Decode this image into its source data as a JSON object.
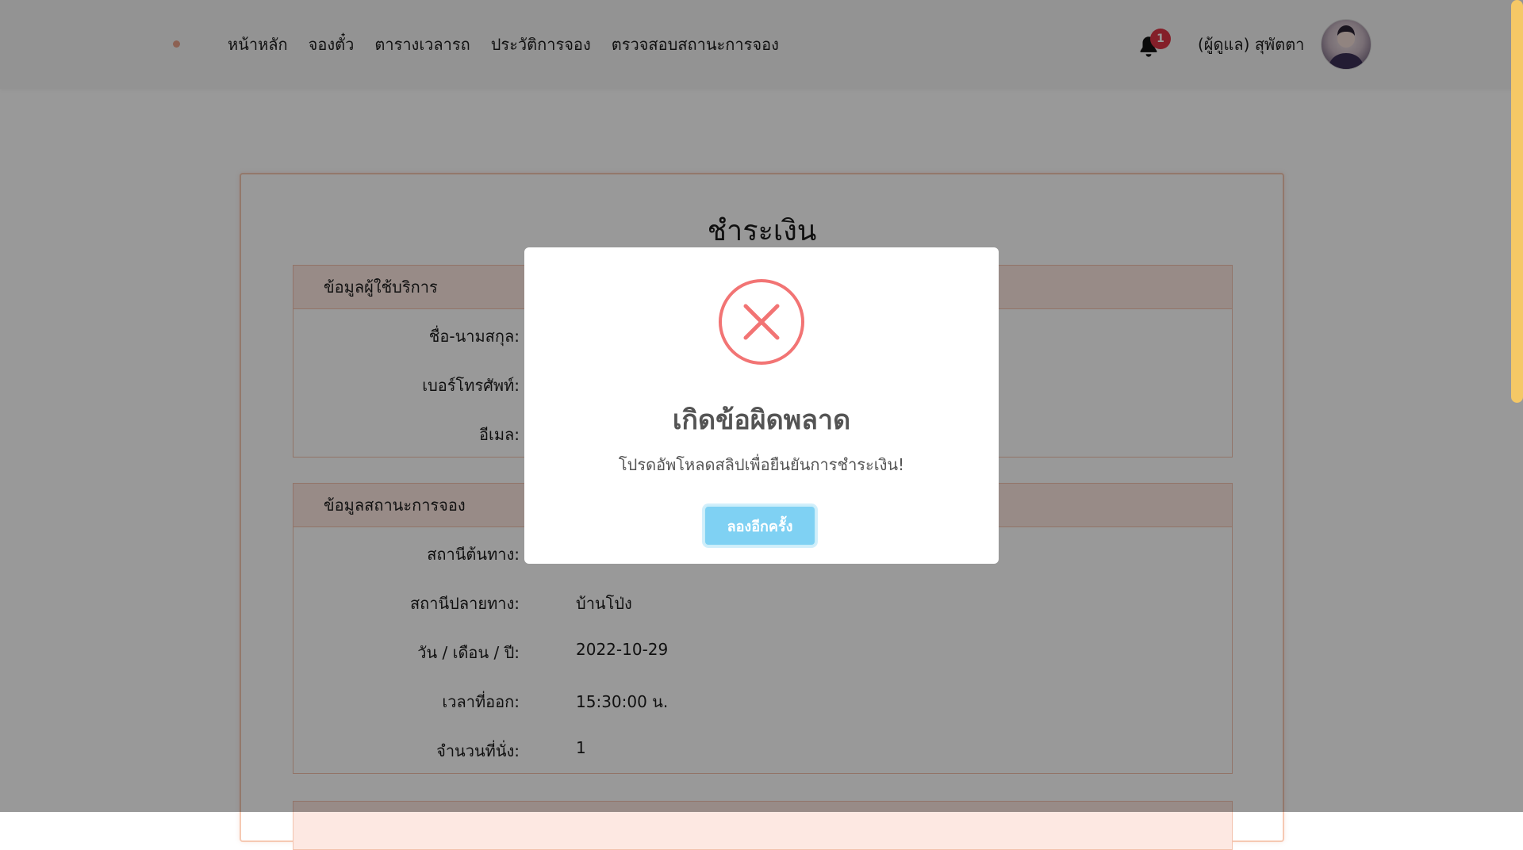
{
  "navbar": {
    "links": [
      "หน้าหลัก",
      "จองตั๋ว",
      "ตารางเวลารถ",
      "ประวัติการจอง",
      "ตรวจสอบสถานะการจอง"
    ],
    "notification_count": "1",
    "user_name": "(ผู้ดูแล) สุพัตตา"
  },
  "page": {
    "title": "ชำระเงิน"
  },
  "user_section": {
    "header": "ข้อมูลผู้ใช้บริการ",
    "rows": [
      {
        "label": "ชื่อ-นามสกุล:",
        "value": ""
      },
      {
        "label": "เบอร์โทรศัพท์:",
        "value": ""
      },
      {
        "label": "อีเมล:",
        "value": ""
      }
    ]
  },
  "booking_section": {
    "header": "ข้อมูลสถานะการจอง",
    "rows": [
      {
        "label": "สถานีต้นทาง:",
        "value": ""
      },
      {
        "label": "สถานีปลายทาง:",
        "value": "บ้านโป่ง"
      },
      {
        "label": "วัน / เดือน / ปี:",
        "value": "2022-10-29"
      },
      {
        "label": "เวลาที่ออก:",
        "value": "15:30:00 น."
      },
      {
        "label": "จำนวนที่นั่ง:",
        "value": "1"
      }
    ]
  },
  "modal": {
    "icon": "error-x-icon",
    "title": "เกิดข้อผิดพลาด",
    "text": "โปรดอัพโหลดสลิปเพื่อยืนยันการชำระเงิน!",
    "button_label": "ลองอีกครั้ง"
  },
  "colors": {
    "accent": "#e9a28b",
    "section_header_bg": "#fde8e2",
    "error_red": "#f27474",
    "button_blue": "#7fd1f3",
    "scrollbar": "#f5c866"
  }
}
